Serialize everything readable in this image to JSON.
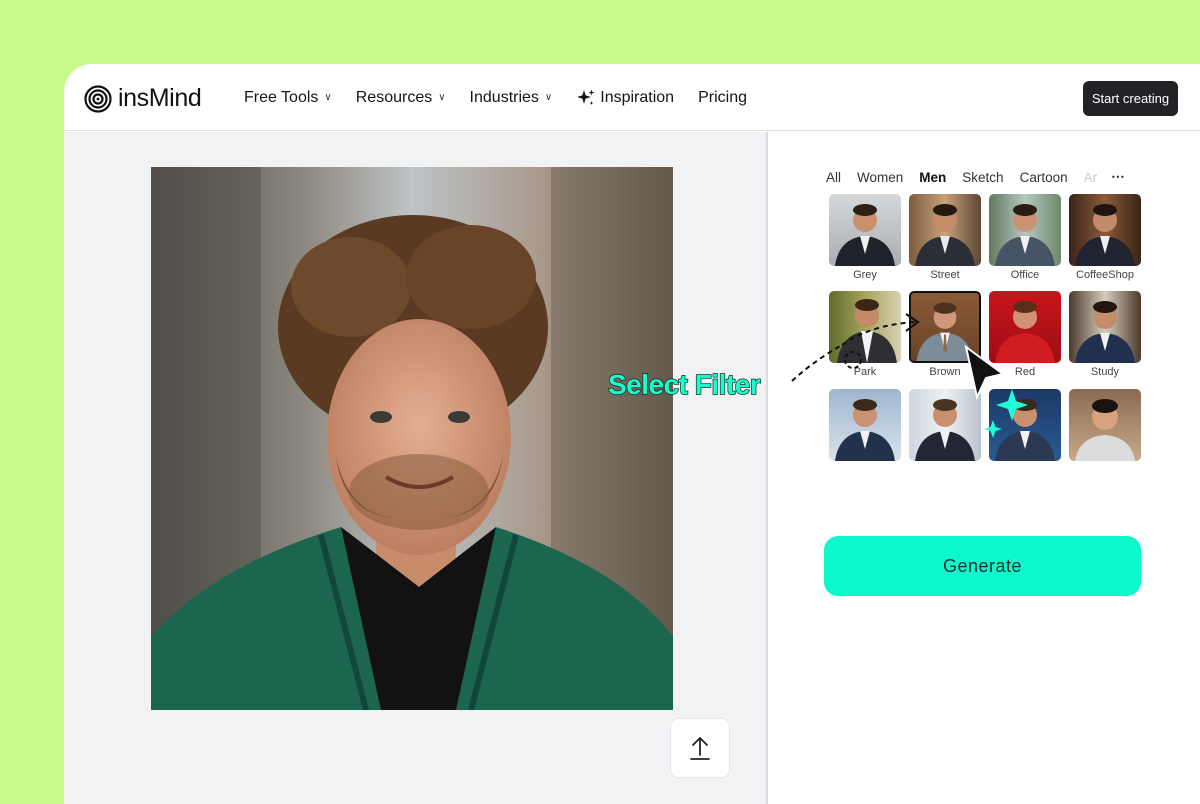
{
  "brand": {
    "name": "insMind"
  },
  "nav": {
    "items": [
      {
        "label": "Free Tools",
        "has_dropdown": true
      },
      {
        "label": "Resources",
        "has_dropdown": true
      },
      {
        "label": "Industries",
        "has_dropdown": true
      },
      {
        "label": "Inspiration",
        "icon": "sparkle-icon"
      },
      {
        "label": "Pricing"
      }
    ],
    "cta_label": "Start creating"
  },
  "filters": {
    "tabs": [
      "All",
      "Women",
      "Men",
      "Sketch",
      "Cartoon",
      "Ar"
    ],
    "active_tab": "Men",
    "more_icon": "more-horizontal-icon",
    "selected": "Brown",
    "items": [
      {
        "label": "Grey"
      },
      {
        "label": "Street"
      },
      {
        "label": "Office"
      },
      {
        "label": "CoffeeShop"
      },
      {
        "label": "Park"
      },
      {
        "label": "Brown"
      },
      {
        "label": "Red"
      },
      {
        "label": "Study"
      },
      {
        "label": ""
      },
      {
        "label": ""
      },
      {
        "label": ""
      },
      {
        "label": ""
      }
    ]
  },
  "generate_label": "Generate",
  "upload_icon": "upload-icon",
  "annotation": {
    "text": "Select Filter"
  },
  "colors": {
    "background": "#c6f88a",
    "accent": "#0ef8cd",
    "cta": "#222326"
  }
}
